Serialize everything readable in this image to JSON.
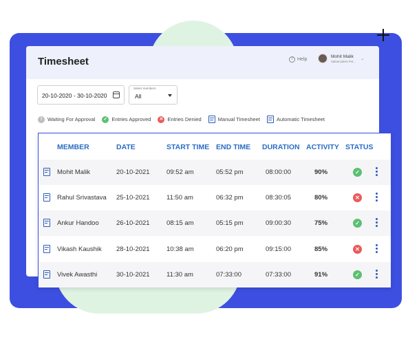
{
  "app": {
    "title": "Timesheet"
  },
  "header": {
    "help_label": "Help",
    "user_name": "Mohit Malik",
    "user_company": "Valuecoders Pvt..."
  },
  "filters": {
    "date_range": "20-10-2020 - 30-10-2020",
    "member_label": "Select members",
    "member_value": "All"
  },
  "legend": [
    {
      "label": "Waiting For Approval",
      "icon": "waiting-icon"
    },
    {
      "label": "Entries Approved",
      "icon": "approved-icon"
    },
    {
      "label": "Entries Denied",
      "icon": "denied-icon"
    },
    {
      "label": "Manual Timesheet",
      "icon": "manual-timesheet-icon"
    },
    {
      "label": "Automatic Timesheet",
      "icon": "automatic-timesheet-icon"
    }
  ],
  "table": {
    "headers": [
      "MEMBER",
      "DATE",
      "START TIME",
      "END TIME",
      "DURATION",
      "ACTIVITY",
      "STATUS"
    ],
    "rows": [
      {
        "member": "Mohit Malik",
        "date": "20-10-2021",
        "start": "09:52 am",
        "end": "05:52 pm",
        "duration": "08:00:00",
        "activity": "90%",
        "status": "approved"
      },
      {
        "member": "Rahul Srivastava",
        "date": "25-10-2021",
        "start": "11:50 am",
        "end": "06:32 pm",
        "duration": "08:30:05",
        "activity": "80%",
        "status": "denied"
      },
      {
        "member": "Ankur Handoo",
        "date": "26-10-2021",
        "start": "08:15 am",
        "end": "05:15 pm",
        "duration": "09:00:30",
        "activity": "75%",
        "status": "approved"
      },
      {
        "member": "Vikash Kaushik",
        "date": "28-10-2021",
        "start": "10:38 am",
        "end": "06:20 pm",
        "duration": "09:15:00",
        "activity": "85%",
        "status": "denied"
      },
      {
        "member": "Vivek Awasthi",
        "date": "30-10-2021",
        "start": "11:30 am",
        "end": "07:33:00",
        "duration": "07:33:00",
        "activity": "91%",
        "status": "approved"
      }
    ]
  },
  "colors": {
    "accent": "#2b6cc4",
    "background_blob": "#3d4fe0",
    "approved": "#5cc072",
    "denied": "#ea5a5a"
  }
}
